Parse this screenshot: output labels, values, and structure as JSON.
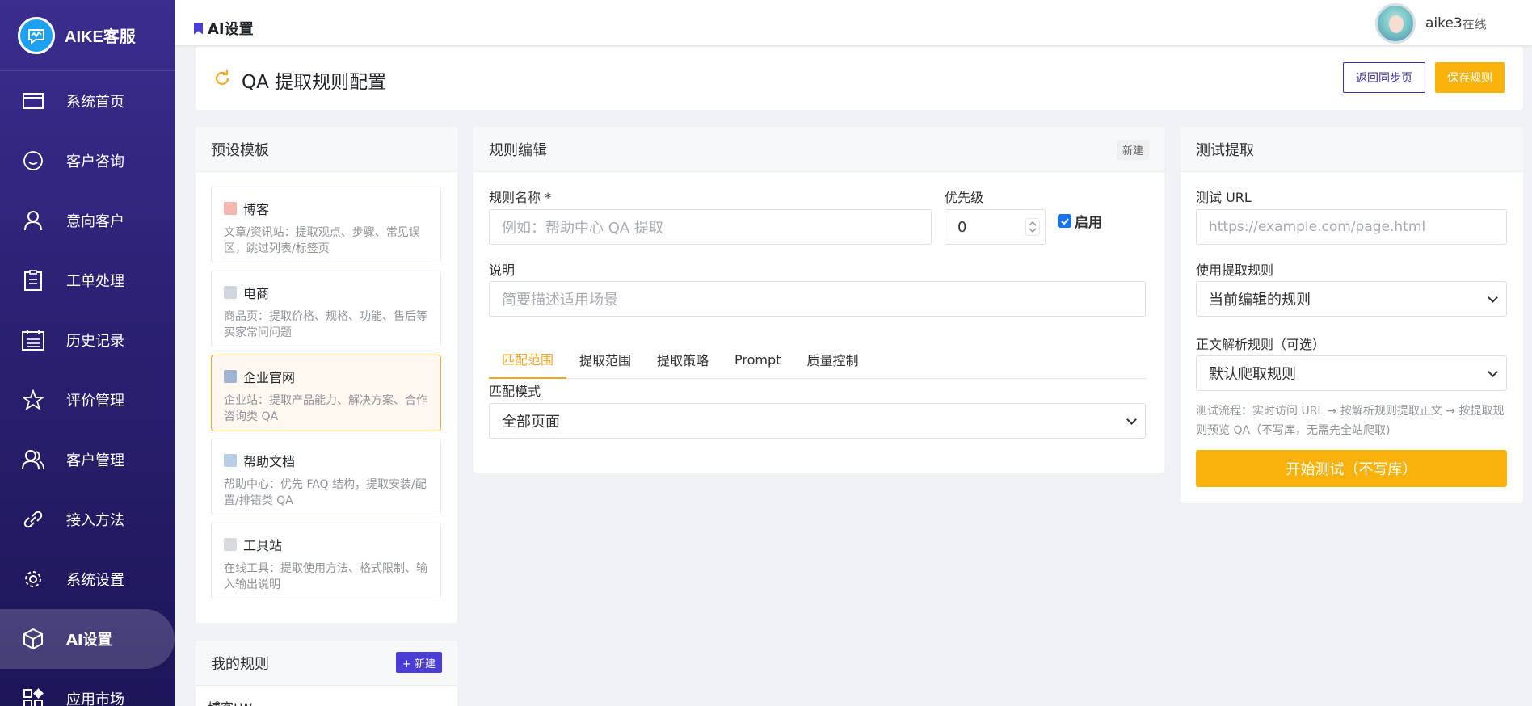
{
  "app": {
    "name": "AIKE客服"
  },
  "sidebar": {
    "items": [
      {
        "label": "系统首页",
        "icon": "browser-window-icon"
      },
      {
        "label": "客户咨询",
        "icon": "chat-bubble-icon"
      },
      {
        "label": "意向客户",
        "icon": "person-icon"
      },
      {
        "label": "工单处理",
        "icon": "clipboard-icon"
      },
      {
        "label": "历史记录",
        "icon": "calendar-list-icon"
      },
      {
        "label": "评价管理",
        "icon": "star-icon"
      },
      {
        "label": "客户管理",
        "icon": "people-icon"
      },
      {
        "label": "接入方法",
        "icon": "link-icon"
      },
      {
        "label": "系统设置",
        "icon": "gear-icon"
      },
      {
        "label": "AI设置",
        "icon": "cube-icon",
        "active": true
      },
      {
        "label": "应用市场",
        "icon": "app-grid-icon"
      }
    ]
  },
  "topbar": {
    "title": "AI设置",
    "user_name": "aike3",
    "user_status": "在线"
  },
  "header": {
    "title": "QA 提取规则配置",
    "back_button": "返回同步页",
    "save_button": "保存规则"
  },
  "templates": {
    "title": "预设模板",
    "items": [
      {
        "title": "博客",
        "desc": "文章/资讯站：提取观点、步骤、常见误区，跳过列表/标签页"
      },
      {
        "title": "电商",
        "desc": "商品页：提取价格、规格、功能、售后等买家常问问题"
      },
      {
        "title": "企业官网",
        "desc": "企业站：提取产品能力、解决方案、合作咨询类 QA",
        "active": true
      },
      {
        "title": "帮助文档",
        "desc": "帮助中心：优先 FAQ 结构，提取安装/配置/排错类 QA"
      },
      {
        "title": "工具站",
        "desc": "在线工具：提取使用方法、格式限制、输入输出说明"
      }
    ]
  },
  "my_rules": {
    "title": "我的规则",
    "new_button": "+ 新建",
    "first_rule": "博客LW"
  },
  "editor": {
    "title": "规则编辑",
    "badge": "新建",
    "name_label": "规则名称 *",
    "name_placeholder": "例如：帮助中心 QA 提取",
    "priority_label": "优先级",
    "priority_value": "0",
    "enable_label": "启用",
    "enabled": true,
    "desc_label": "说明",
    "desc_placeholder": "简要描述适用场景",
    "tabs": [
      "匹配范围",
      "提取范围",
      "提取策略",
      "Prompt",
      "质量控制"
    ],
    "active_tab": 0,
    "match_mode_label": "匹配模式",
    "match_mode_value": "全部页面"
  },
  "test": {
    "title": "测试提取",
    "url_label": "测试 URL",
    "url_placeholder": "https://example.com/page.html",
    "rule_label": "使用提取规则",
    "rule_value": "当前编辑的规则",
    "parse_label": "正文解析规则（可选）",
    "parse_value": "默认爬取规则",
    "hint": "测试流程：实时访问 URL → 按解析规则提取正文 → 按提取规则预览 QA（不写库，无需先全站爬取)",
    "start_button": "开始测试（不写库）"
  },
  "colors": {
    "accent": "#f9b10b",
    "brand": "#3b2d8f",
    "primary_button": "#4a3dd6",
    "active_tab": "#f5a623"
  }
}
